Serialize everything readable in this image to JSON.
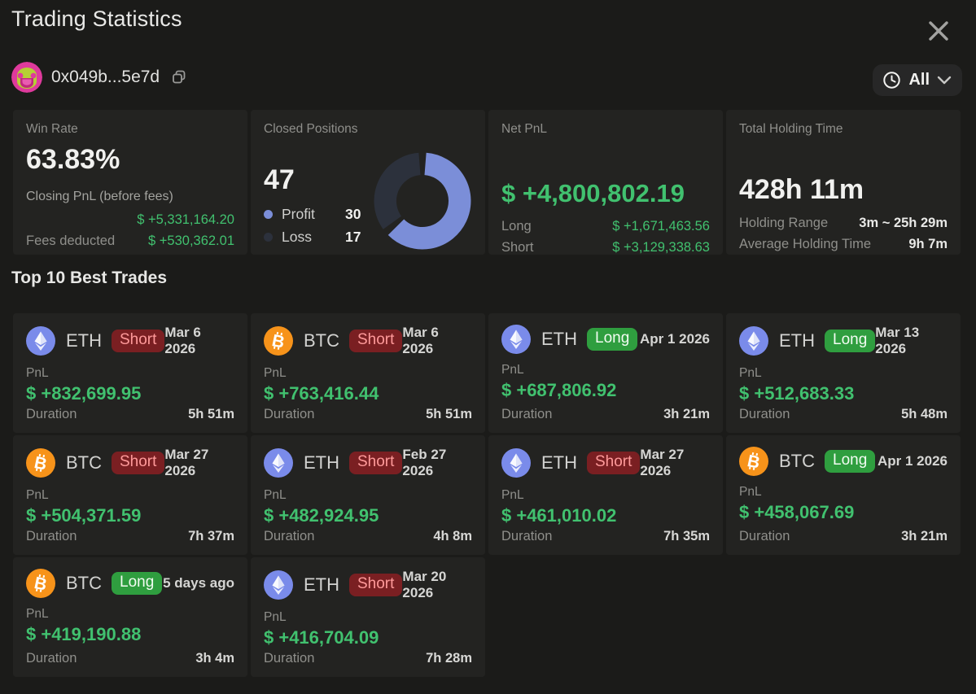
{
  "header": {
    "title": "Trading Statistics",
    "wallet_address": "0x049b...5e7d",
    "filter_label": "All"
  },
  "icons": {
    "close": "close-icon",
    "copy": "copy-icon",
    "clock": "clock-icon",
    "chevron_down": "chevron-down-icon",
    "wallet_avatar": "identicon-avatar",
    "btc": "btc-coin-icon",
    "eth": "eth-coin-icon"
  },
  "stats": {
    "win_rate": {
      "label": "Win Rate",
      "value": "63.83%",
      "closing_pnl_label": "Closing PnL (before fees)",
      "closing_pnl_value": "$ +5,331,164.20",
      "fees_label": "Fees deducted",
      "fees_value": "$ +530,362.01"
    },
    "closed_positions": {
      "label": "Closed Positions",
      "value": "47",
      "profit_label": "Profit",
      "profit_value": "30",
      "loss_label": "Loss",
      "loss_value": "17"
    },
    "net_pnl": {
      "label": "Net PnL",
      "value": "$ +4,800,802.19",
      "long_label": "Long",
      "long_value": "$ +1,671,463.56",
      "short_label": "Short",
      "short_value": "$ +3,129,338.63"
    },
    "holding_time": {
      "label": "Total Holding Time",
      "value": "428h 11m",
      "range_label": "Holding Range",
      "range_value": "3m ~ 25h 29m",
      "avg_label": "Average Holding Time",
      "avg_value": "9h 7m"
    }
  },
  "chart_data": {
    "type": "pie",
    "title": "Closed Positions",
    "categories": [
      "Profit",
      "Loss"
    ],
    "values": [
      30,
      17
    ],
    "total": 47,
    "colors": [
      "#7b8ed8",
      "#2c313c"
    ],
    "legend_position": "left"
  },
  "trades_section": {
    "title": "Top 10 Best Trades",
    "pnl_label": "PnL",
    "duration_label": "Duration"
  },
  "trades": [
    {
      "coin": "ETH",
      "side": "Short",
      "date": "Mar 6 2026",
      "pnl": "$ +832,699.95",
      "duration": "5h 51m"
    },
    {
      "coin": "BTC",
      "side": "Short",
      "date": "Mar 6 2026",
      "pnl": "$ +763,416.44",
      "duration": "5h 51m"
    },
    {
      "coin": "ETH",
      "side": "Long",
      "date": "Apr 1 2026",
      "pnl": "$ +687,806.92",
      "duration": "3h 21m"
    },
    {
      "coin": "ETH",
      "side": "Long",
      "date": "Mar 13 2026",
      "pnl": "$ +512,683.33",
      "duration": "5h 48m"
    },
    {
      "coin": "BTC",
      "side": "Short",
      "date": "Mar 27 2026",
      "pnl": "$ +504,371.59",
      "duration": "7h 37m"
    },
    {
      "coin": "ETH",
      "side": "Short",
      "date": "Feb 27 2026",
      "pnl": "$ +482,924.95",
      "duration": "4h 8m"
    },
    {
      "coin": "ETH",
      "side": "Short",
      "date": "Mar 27 2026",
      "pnl": "$ +461,010.02",
      "duration": "7h 35m"
    },
    {
      "coin": "BTC",
      "side": "Long",
      "date": "Apr 1 2026",
      "pnl": "$ +458,067.69",
      "duration": "3h 21m"
    },
    {
      "coin": "BTC",
      "side": "Long",
      "date": "5 days ago",
      "pnl": "$ +419,190.88",
      "duration": "3h 4m"
    },
    {
      "coin": "ETH",
      "side": "Short",
      "date": "Mar 20 2026",
      "pnl": "$ +416,704.09",
      "duration": "7h 28m"
    }
  ],
  "colors": {
    "background": "#1b1b19",
    "card": "#232321",
    "green": "#41c16f",
    "profit_blue": "#7b8ed8",
    "loss_dark": "#2c313c",
    "short_badge_bg": "#7a1f22",
    "short_badge_text": "#ff9a9a",
    "long_badge_bg": "#2f9e3f",
    "btc_orange": "#f7931a",
    "eth_blue": "#7a8bea"
  }
}
